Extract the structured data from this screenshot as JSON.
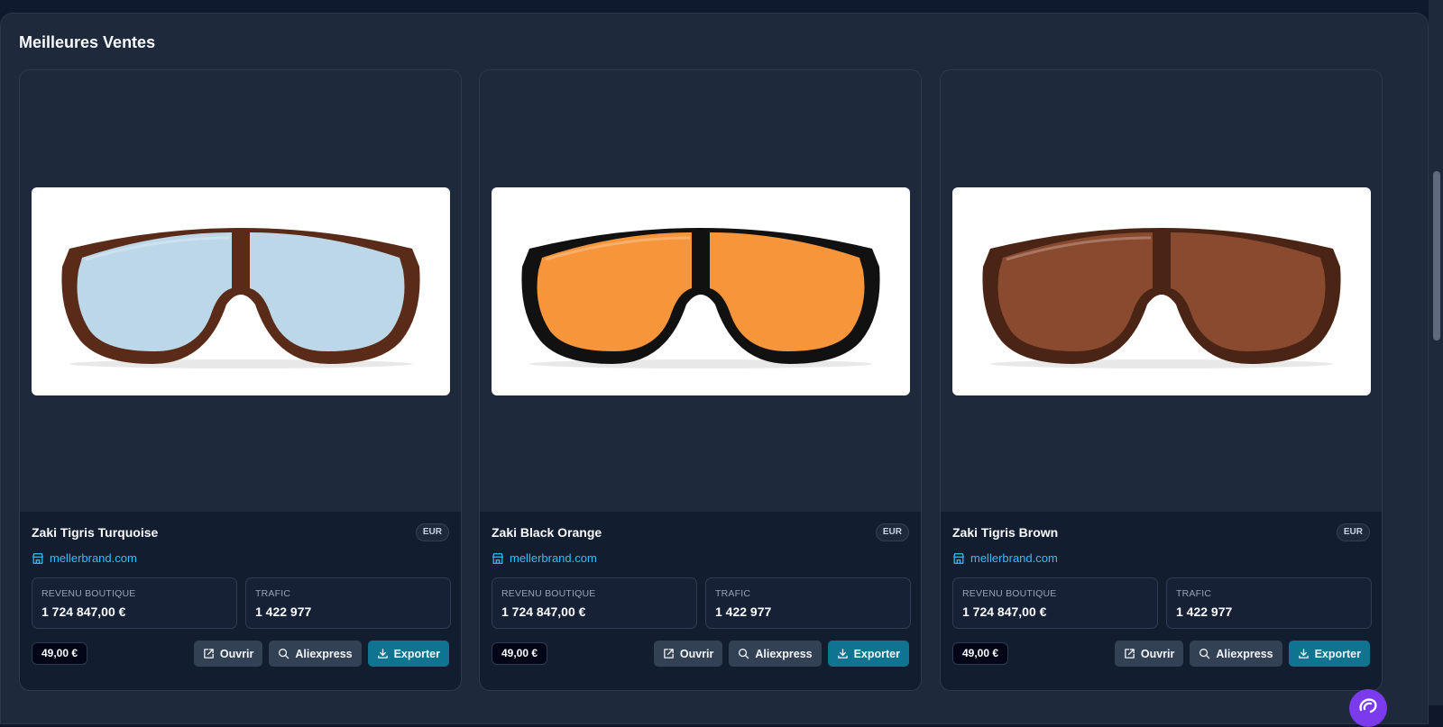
{
  "section": {
    "title": "Meilleures Ventes"
  },
  "labels": {
    "revenue": "REVENU BOUTIQUE",
    "traffic": "TRAFIC",
    "open": "Ouvrir",
    "aliexpress": "Aliexpress",
    "export": "Exporter"
  },
  "products": [
    {
      "name": "Zaki Tigris Turquoise",
      "currency": "EUR",
      "store": "mellerbrand.com",
      "revenue": "1 724 847,00 €",
      "traffic": "1 422 977",
      "price": "49,00 €",
      "lens_color": "#bcd8e8",
      "frame_color": "#5a2b18"
    },
    {
      "name": "Zaki Black Orange",
      "currency": "EUR",
      "store": "mellerbrand.com",
      "revenue": "1 724 847,00 €",
      "traffic": "1 422 977",
      "price": "49,00 €",
      "lens_color": "#f7953a",
      "frame_color": "#111111"
    },
    {
      "name": "Zaki Tigris Brown",
      "currency": "EUR",
      "store": "mellerbrand.com",
      "revenue": "1 724 847,00 €",
      "traffic": "1 422 977",
      "price": "49,00 €",
      "lens_color": "#8a4a30",
      "frame_color": "#4a2414"
    }
  ],
  "icons": {
    "store": "store-icon",
    "open": "external-link-icon",
    "search": "search-icon",
    "export": "download-icon",
    "chat": "chat-icon"
  },
  "colors": {
    "accent": "#38bdf8",
    "primary_button": "#0e7490",
    "chat": "#7c3aed"
  }
}
